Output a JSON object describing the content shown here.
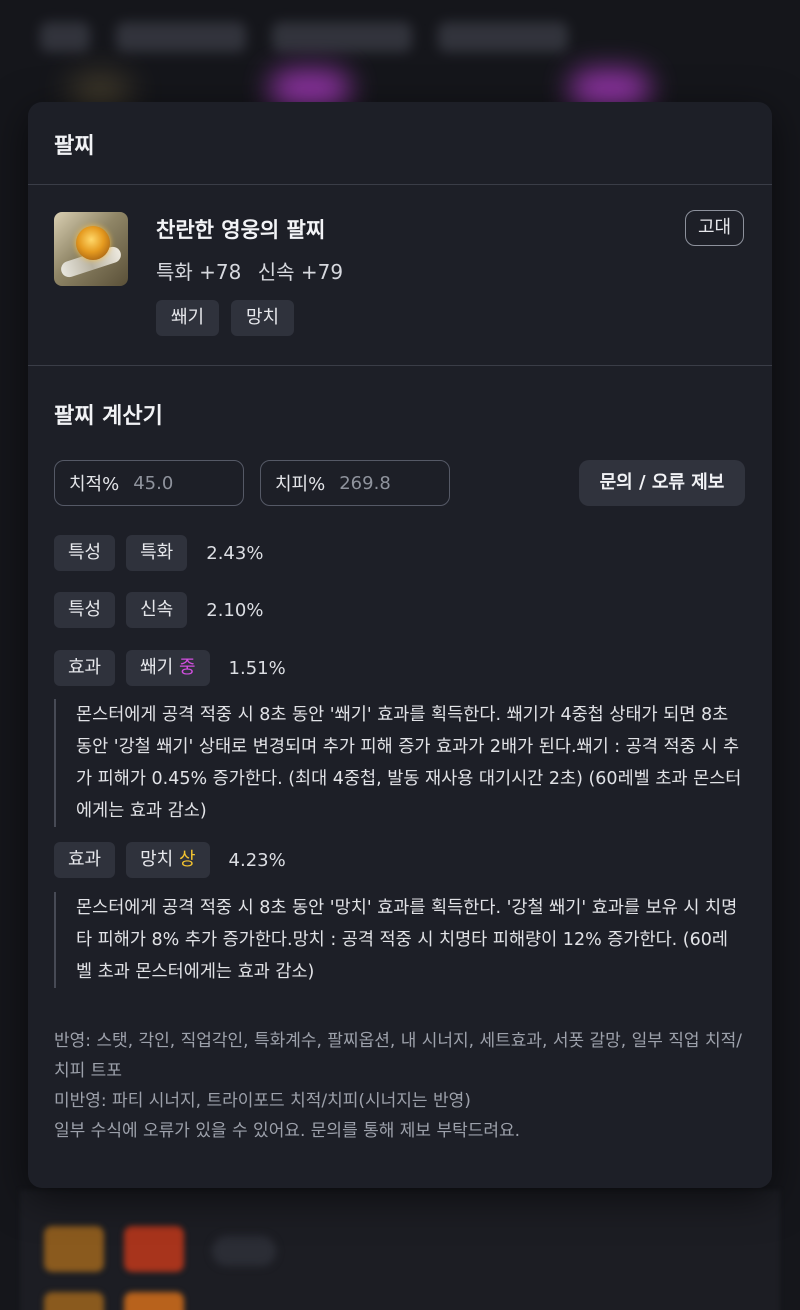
{
  "popup": {
    "title": "팔찌",
    "item": {
      "name": "찬란한 영웅의 팔찌",
      "grade": "고대",
      "stats": [
        "특화 +78",
        "신속 +79"
      ],
      "tags": [
        "쐐기",
        "망치"
      ],
      "icon": "bracelet-icon"
    },
    "calculator": {
      "title": "팔찌 계산기",
      "crit_rate_label": "치적%",
      "crit_rate_value": "45.0",
      "crit_dmg_label": "치피%",
      "crit_dmg_value": "269.8",
      "report_button": "문의 / 오류 제보",
      "rows": [
        {
          "kind": "특성",
          "name": "특화",
          "grade": "",
          "value": "2.43%"
        },
        {
          "kind": "특성",
          "name": "신속",
          "grade": "",
          "value": "2.10%"
        },
        {
          "kind": "효과",
          "name": "쐐기",
          "grade": "중",
          "value": "1.51%",
          "description": "몬스터에게 공격 적중 시 8초 동안 '쐐기' 효과를 획득한다. 쐐기가 4중첩 상태가 되면 8초 동안 '강철 쐐기' 상태로 변경되며 추가 피해 증가 효과가 2배가 된다.쐐기 : 공격 적중 시 추가 피해가 0.45% 증가한다. (최대 4중첩, 발동 재사용 대기시간 2초) (60레벨 초과 몬스터에게는 효과 감소)"
        },
        {
          "kind": "효과",
          "name": "망치",
          "grade": "상",
          "value": "4.23%",
          "description": "몬스터에게 공격 적중 시 8초 동안 '망치' 효과를 획득한다. '강철 쐐기' 효과를 보유 시 치명타 피해가 8% 추가 증가한다.망치 : 공격 적중 시 치명타 피해량이 12% 증가한다. (60레벨 초과 몬스터에게는 효과 감소)"
        }
      ],
      "notes": [
        "반영: 스탯, 각인, 직업각인, 특화계수, 팔찌옵션, 내 시너지, 세트효과, 서폿 갈망, 일부 직업 치적/치피 트포",
        "미반영: 파티 시너지, 트라이포드 치적/치피(시너지는 반영)",
        "일부 수식에 오류가 있을 수 있어요. 문의를 통해 제보 부탁드려요."
      ]
    }
  },
  "colors": {
    "grade_mid": "#d24fe0",
    "grade_high": "#f2c230",
    "card_bg": "#1d1f27"
  }
}
